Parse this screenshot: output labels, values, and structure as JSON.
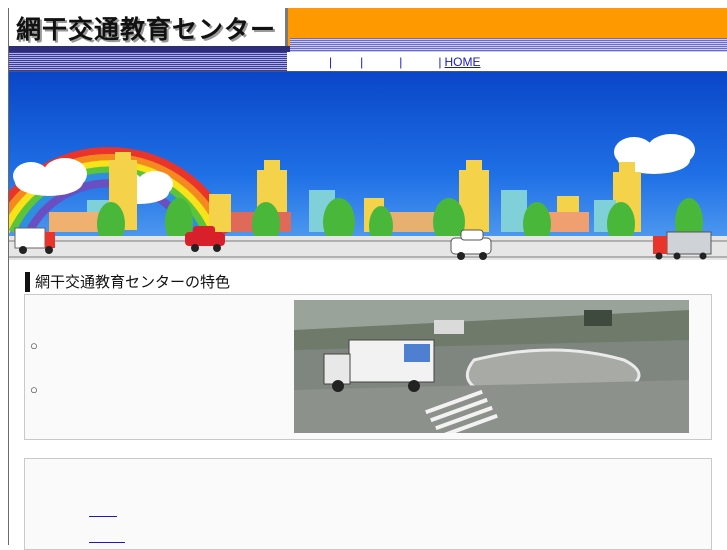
{
  "header": {
    "title": "網干交通教育センター"
  },
  "nav": {
    "items": [
      "",
      "",
      "",
      ""
    ],
    "home_label": "HOME",
    "separator": "|"
  },
  "features": {
    "heading": "網干交通教育センターの特色",
    "bullets": [
      "○",
      "○"
    ]
  },
  "colors": {
    "accent_orange": "#ff9900",
    "stripe_blue": "#3b3b9c",
    "sky_blue": "#1f70e6",
    "link_blue": "#1a1ac0"
  }
}
